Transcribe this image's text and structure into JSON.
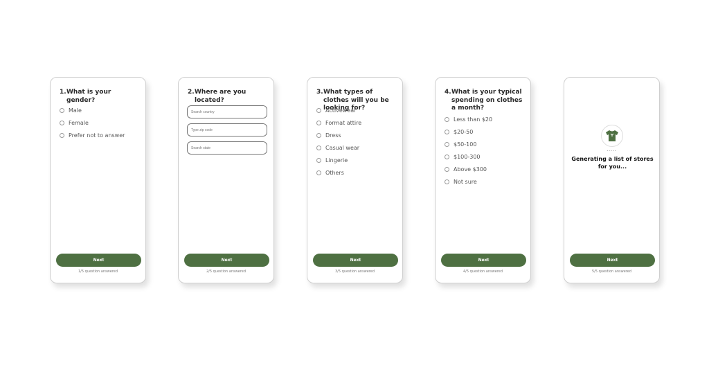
{
  "accent_color": "#4e7042",
  "cards": [
    {
      "num": "1.",
      "title": "What is your gender?",
      "options": [
        "Male",
        "Female",
        "Prefer not to answer"
      ],
      "next": "Next",
      "progress": "1/5 question answered"
    },
    {
      "num": "2.",
      "title": "Where are you located?",
      "fields": [
        "Search country",
        "Type zip code",
        "Search state"
      ],
      "next": "Next",
      "progress": "2/5 question answered"
    },
    {
      "num": "3.",
      "title": "What types of clothes will you be looking for?",
      "options": [
        "Activewear",
        "Format attire",
        "Dress",
        "Casual wear",
        "Lingerie",
        "Others"
      ],
      "next": "Next",
      "progress": "3/5 question answered"
    },
    {
      "num": "4.",
      "title": "What is your typical spending on clothes a month?",
      "options": [
        "Less than $20",
        "$20-50",
        "$50-100",
        "$100-300",
        "Above $300",
        "Not sure"
      ],
      "next": "Next",
      "progress": "4/5 question answered"
    },
    {
      "icon": "tshirt-icon",
      "dots": ".....",
      "message": "Generating a list of stores for you...",
      "next": "Next",
      "progress": "5/5 question answered"
    }
  ]
}
